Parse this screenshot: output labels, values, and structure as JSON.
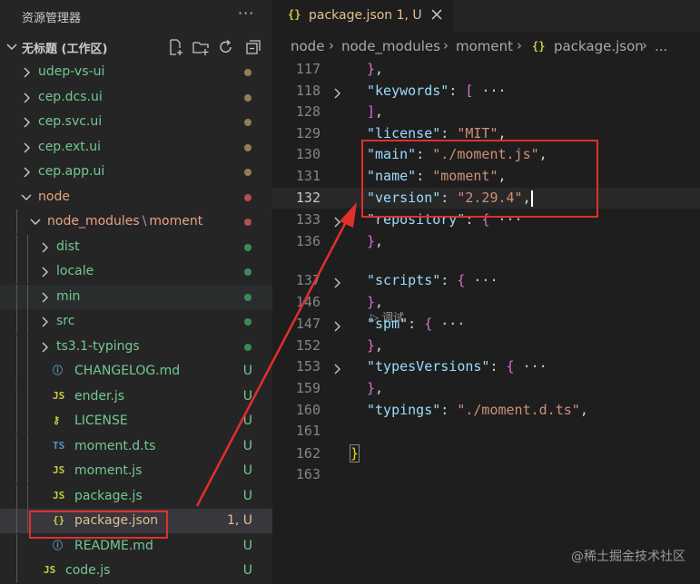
{
  "sidebar": {
    "title": "资源管理器",
    "more": "···",
    "workspace": "无标题 (工作区)",
    "tree": [
      {
        "name": "udep-vs-ui",
        "color": "#73c991",
        "dot": "#8e7f56"
      },
      {
        "name": "cep.dcs.ui",
        "color": "#73c991",
        "dot": "#8e7f56"
      },
      {
        "name": "cep.svc.ui",
        "color": "#73c991",
        "dot": "#8e7f56"
      },
      {
        "name": "cep.ext.ui",
        "color": "#73c991",
        "dot": "#8e7f56"
      },
      {
        "name": "cep.app.ui",
        "color": "#73c991",
        "dot": "#8e7f56"
      },
      {
        "name": "node",
        "color": "#e8a57c",
        "dot": "#b05050"
      },
      {
        "name": "node_modules",
        "sep": "\\",
        "name2": "moment",
        "color": "#e8a57c",
        "dot": "#b05050"
      },
      {
        "name": "dist",
        "color": "#73c991",
        "dot": "#3c8a5c"
      },
      {
        "name": "locale",
        "color": "#73c991",
        "dot": "#3c8a5c"
      },
      {
        "name": "min",
        "color": "#73c991",
        "dot": "#3c8a5c"
      },
      {
        "name": "src",
        "color": "#73c991",
        "dot": "#3c8a5c"
      },
      {
        "name": "ts3.1-typings",
        "color": "#73c991",
        "dot": "#3c8a5c"
      },
      {
        "name": "CHANGELOG.md",
        "icon": "ⓘ",
        "iconColor": "#519aba",
        "status": "U"
      },
      {
        "name": "ender.js",
        "icon": "JS",
        "iconColor": "#cbcb41",
        "status": "U"
      },
      {
        "name": "LICENSE",
        "icon": "⚷",
        "iconColor": "#cbcb41",
        "status": "U"
      },
      {
        "name": "moment.d.ts",
        "icon": "TS",
        "iconColor": "#519aba",
        "status": "U"
      },
      {
        "name": "moment.js",
        "icon": "JS",
        "iconColor": "#cbcb41",
        "status": "U"
      },
      {
        "name": "package.js",
        "icon": "JS",
        "iconColor": "#cbcb41",
        "status": "U"
      },
      {
        "name": "package.json",
        "icon": "{}",
        "iconColor": "#cbcb41",
        "status": "1, U"
      },
      {
        "name": "README.md",
        "icon": "ⓘ",
        "iconColor": "#519aba",
        "status": "U"
      },
      {
        "name": "code.js",
        "icon": "JS",
        "iconColor": "#cbcb41",
        "status": "U"
      }
    ]
  },
  "editor": {
    "tab": {
      "icon": "{}",
      "label": "package.json 1, U"
    },
    "breadcrumbs": [
      "node",
      "node_modules",
      "moment",
      "package.json",
      "..."
    ],
    "breadcrumb_icon": "{}",
    "codelens": "▷ 调试",
    "lines": [
      {
        "n": "117",
        "text": "},"
      },
      {
        "n": "118",
        "text": "\"keywords\": [ ···"
      },
      {
        "n": "128",
        "text": "],"
      },
      {
        "n": "129",
        "text": "\"license\": \"MIT\","
      },
      {
        "n": "130",
        "text": "\"main\": \"./moment.js\","
      },
      {
        "n": "131",
        "text": "\"name\": \"moment\","
      },
      {
        "n": "132",
        "text": "\"version\": \"2.29.4\","
      },
      {
        "n": "133",
        "text": "\"repository\": { ···"
      },
      {
        "n": "136",
        "text": "},"
      },
      {
        "n": "137",
        "text": "\"scripts\": { ···"
      },
      {
        "n": "146",
        "text": "},"
      },
      {
        "n": "147",
        "text": "\"spm\": { ···"
      },
      {
        "n": "152",
        "text": "},"
      },
      {
        "n": "153",
        "text": "\"typesVersions\": { ···"
      },
      {
        "n": "159",
        "text": "},"
      },
      {
        "n": "160",
        "text": "\"typings\": \"./moment.d.ts\","
      },
      {
        "n": "161",
        "text": ""
      },
      {
        "n": "162",
        "text": "}"
      },
      {
        "n": "163",
        "text": ""
      }
    ]
  },
  "watermark": "@稀土掘金技术社区",
  "colors": {
    "accent_red": "#e0302a",
    "sidebar_bg": "#252526",
    "editor_bg": "#1e1e1e"
  }
}
